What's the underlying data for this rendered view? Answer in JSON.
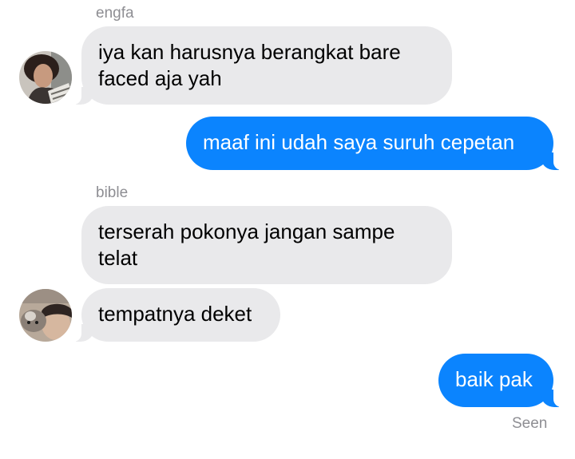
{
  "conversation": {
    "messages": [
      {
        "sender": "engfa",
        "text": "iya kan harusnya berangkat bare faced aja yah"
      },
      {
        "sender": "me",
        "text": "maaf ini udah saya suruh cepetan"
      },
      {
        "sender": "bible",
        "text": "terserah pokonya jangan sampe telat"
      },
      {
        "sender": "bible",
        "text": "tempatnya deket"
      },
      {
        "sender": "me",
        "text": "baik pak"
      }
    ],
    "read_receipt": "Seen"
  },
  "avatars": [
    {
      "name": "engfa",
      "icon": "engfa-avatar"
    },
    {
      "name": "bible",
      "icon": "bible-avatar"
    }
  ],
  "colors": {
    "incoming_bubble": "#e9e9eb",
    "outgoing_bubble": "#0b84fe",
    "sender_label": "#8e8e93"
  }
}
